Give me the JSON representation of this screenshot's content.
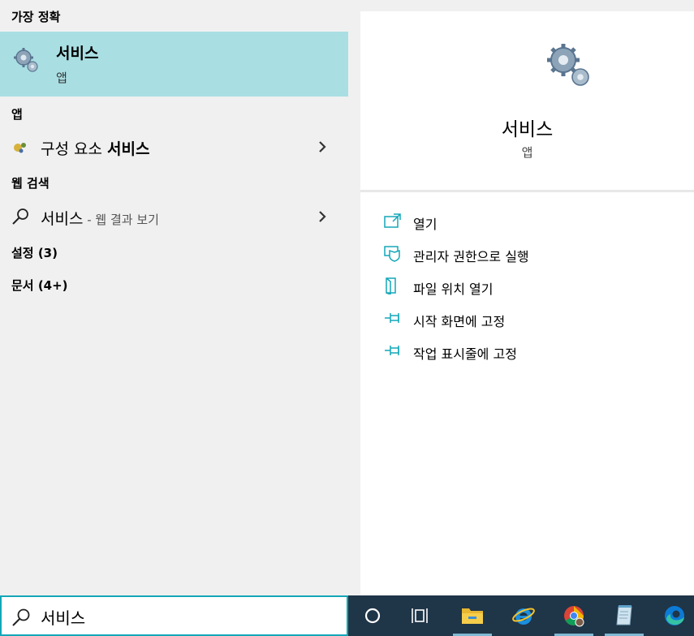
{
  "left": {
    "best_match_header": "가장 정확",
    "best_match": {
      "title": "서비스",
      "subtitle": "앱",
      "icon": "gears-icon"
    },
    "apps_header": "앱",
    "apps": [
      {
        "label_prefix": "구성 요소 ",
        "label_bold": "서비스",
        "icon": "component-services-icon"
      }
    ],
    "web_header": "웹 검색",
    "web": {
      "query": "서비스",
      "suffix": " - 웹 결과 보기",
      "icon": "search-icon"
    },
    "settings_header": "설정 (3)",
    "documents_header": "문서 (4+)"
  },
  "right": {
    "title": "서비스",
    "subtitle": "앱",
    "actions": [
      {
        "label": "열기",
        "icon": "open-icon"
      },
      {
        "label": "관리자 권한으로 실행",
        "icon": "run-as-admin-icon"
      },
      {
        "label": "파일 위치 열기",
        "icon": "file-location-icon"
      },
      {
        "label": "시작 화면에 고정",
        "icon": "pin-start-icon"
      },
      {
        "label": "작업 표시줄에 고정",
        "icon": "pin-taskbar-icon"
      }
    ]
  },
  "search": {
    "value": "서비스"
  },
  "taskbar": {
    "items": [
      "cortana-icon",
      "task-view-icon",
      "file-explorer-icon",
      "internet-explorer-icon",
      "chrome-icon",
      "notepad-icon",
      "edge-icon"
    ]
  },
  "colors": {
    "selected": "#a9dfe3",
    "accent": "#13a7b8",
    "taskbar": "#1f3548"
  }
}
